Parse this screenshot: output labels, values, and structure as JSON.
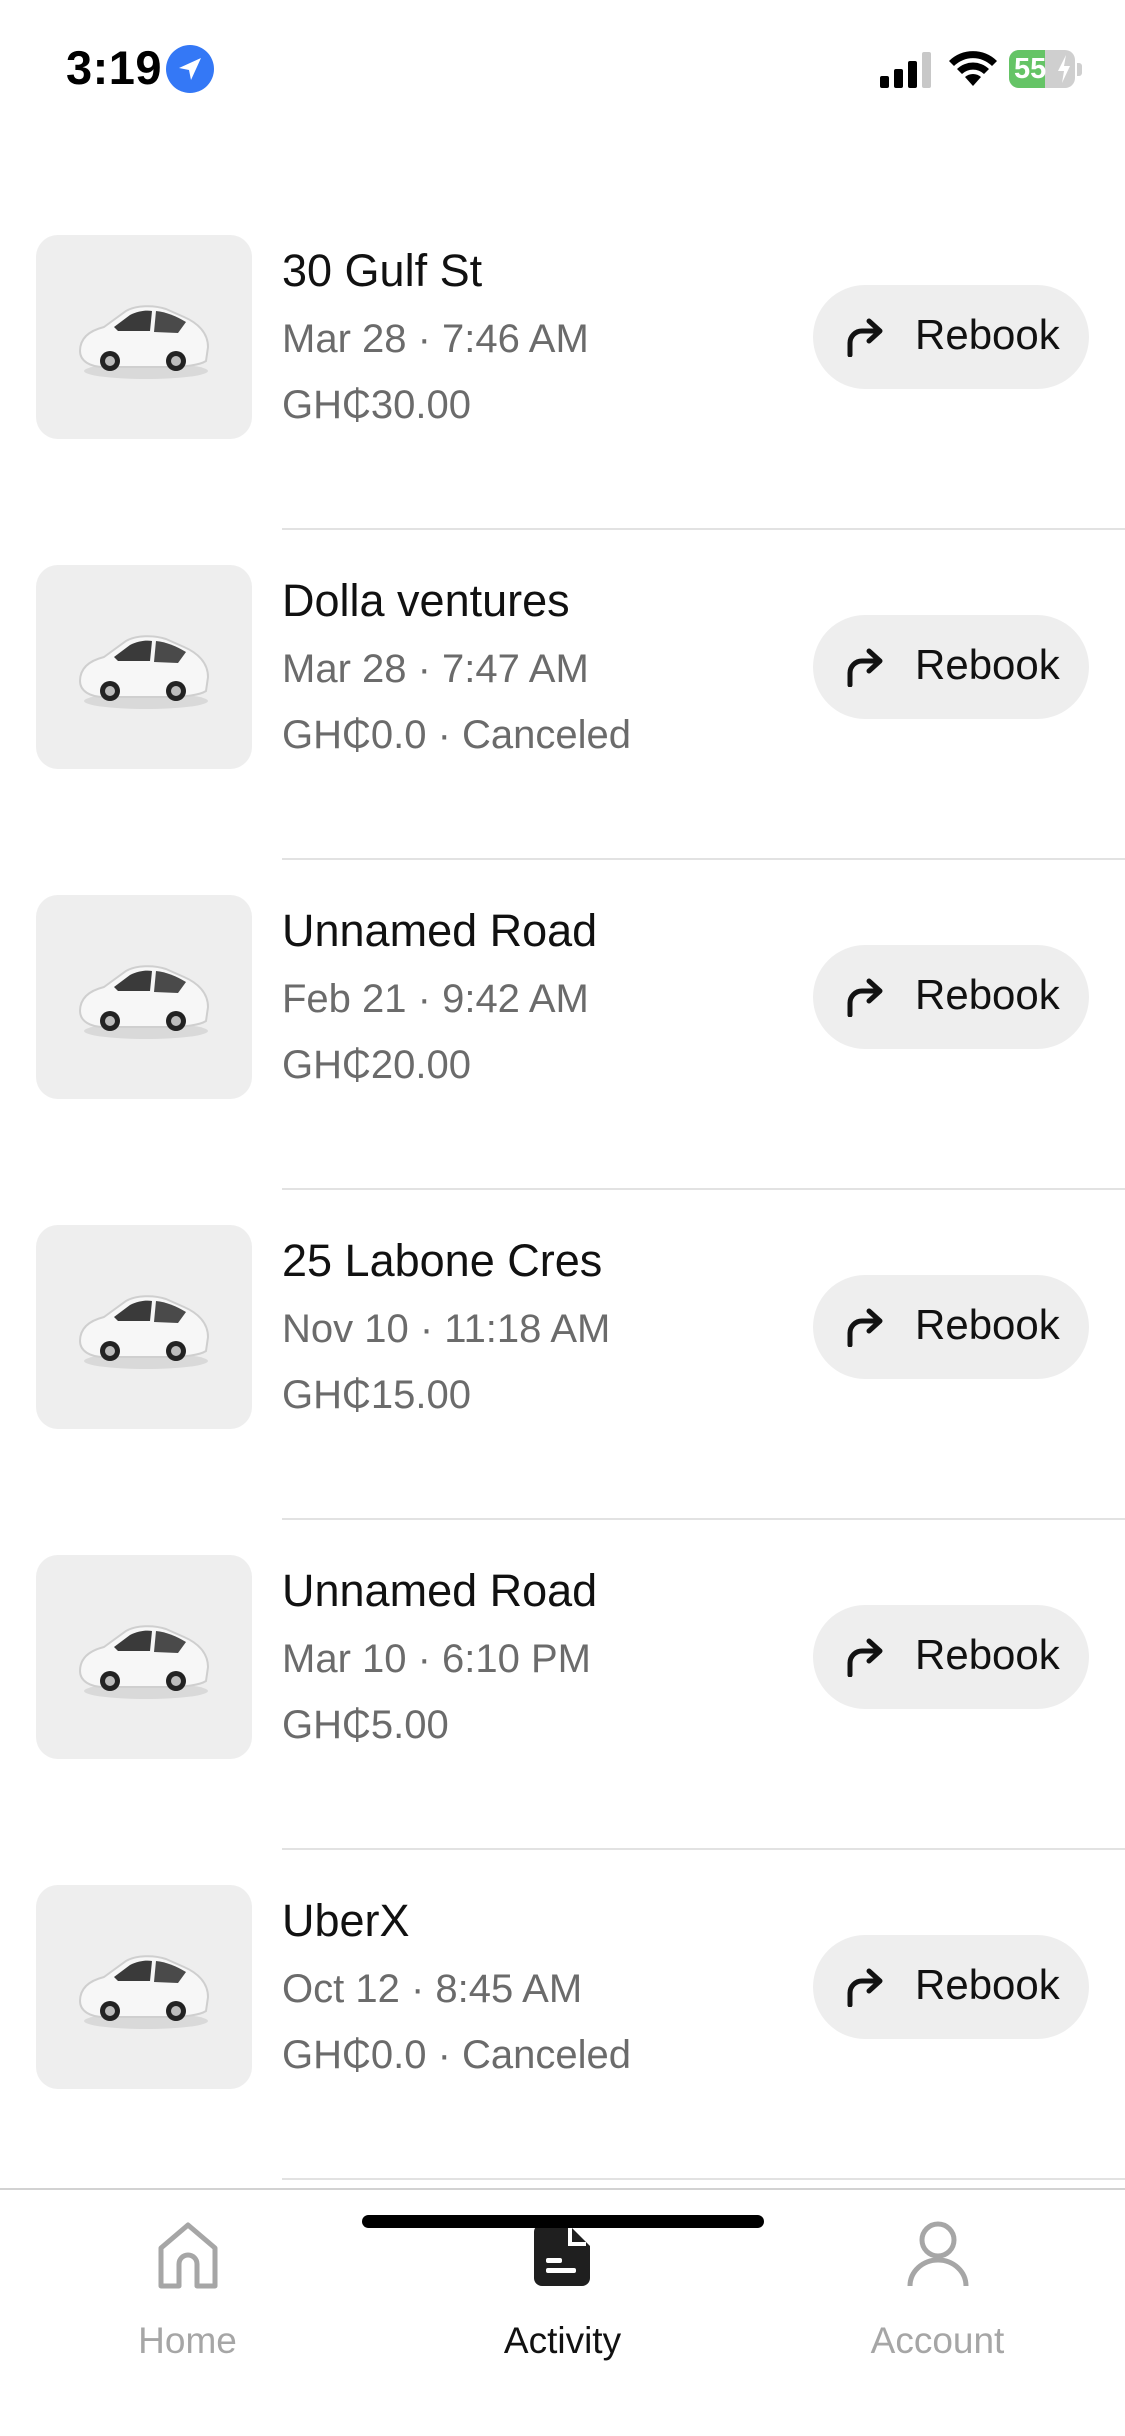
{
  "status_bar": {
    "time": "3:19",
    "battery_level": "55",
    "battery_fraction": 0.55,
    "icons": [
      "location-arrow-icon",
      "cellular-signal-icon",
      "wifi-icon",
      "battery-charging-icon"
    ]
  },
  "trips": [
    {
      "title": "30 Gulf St",
      "datetime": "Mar 28 · 7:46 AM",
      "price": "GH₵30.00",
      "rebook_label": "Rebook"
    },
    {
      "title": "Dolla ventures",
      "datetime": "Mar 28 · 7:47 AM",
      "price": "GH₵0.0 · Canceled",
      "rebook_label": "Rebook"
    },
    {
      "title": "Unnamed Road",
      "datetime": "Feb 21 · 9:42 AM",
      "price": "GH₵20.00",
      "rebook_label": "Rebook"
    },
    {
      "title": "25 Labone Cres",
      "datetime": "Nov 10 · 11:18 AM",
      "price": "GH₵15.00",
      "rebook_label": "Rebook"
    },
    {
      "title": "Unnamed Road",
      "datetime": "Mar 10 · 6:10 PM",
      "price": "GH₵5.00",
      "rebook_label": "Rebook"
    },
    {
      "title": "UberX",
      "datetime": "Oct 12 · 8:45 AM",
      "price": "GH₵0.0 · Canceled",
      "rebook_label": "Rebook"
    }
  ],
  "bottom_nav": {
    "items": [
      {
        "label": "Home",
        "icon": "home-icon",
        "active": false
      },
      {
        "label": "Activity",
        "icon": "activity-icon",
        "active": true
      },
      {
        "label": "Account",
        "icon": "account-icon",
        "active": false
      }
    ]
  },
  "colors": {
    "accent_location": "#3478f6",
    "battery_green": "#65c466",
    "muted_text": "#6b6b6b",
    "pill_background": "#eeeeee",
    "inactive_nav": "#a6a6a6"
  }
}
